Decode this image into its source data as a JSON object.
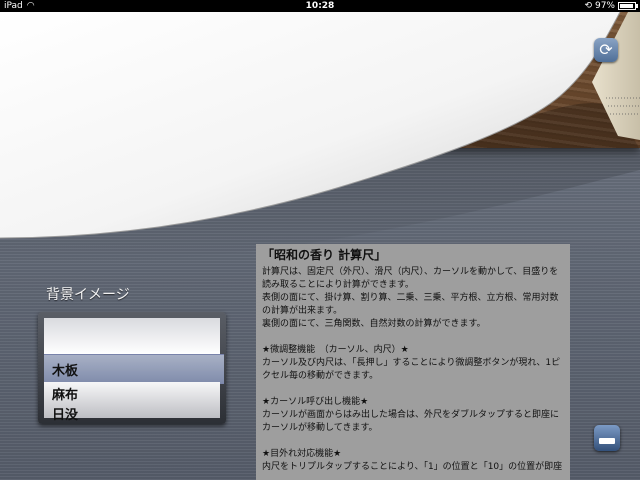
{
  "status_bar": {
    "device": "iPad",
    "time": "10:28",
    "battery": "97%"
  },
  "picker": {
    "label": "背景イメージ",
    "options": [
      "木板",
      "麻布",
      "日没"
    ],
    "selected": "木板"
  },
  "text_panel": {
    "title": "「昭和の香り 計算尺」",
    "paragraphs": [
      "計算尺は、固定尺（外尺）、滑尺（内尺）、カーソルを動かして、目盛りを読み取ることにより計算ができます。",
      "表側の面にて、掛け算、割り算、二乗、三乗、平方根、立方根、常用対数の計算が出来ます。",
      "裏側の面にて、三角関数、自然対数の計算ができます。",
      "",
      "★微調整機能　（カーソル、内尺）★",
      "カーソル及び内尺は、「長押し」することにより微調整ボタンが現れ、1ピクセル毎の移動ができます。",
      "",
      "★カーソル呼び出し機能★",
      "カーソルが画面からはみ出した場合は、外尺をダブルタップすると即座にカーソルが移動してきます。",
      "",
      "★目外れ対応機能★",
      "内尺をトリプルタップすることにより、「1」の位置と「10」の位置が即座"
    ]
  },
  "icons": {
    "refresh": "refresh-icon",
    "ruler": "ruler-icon"
  }
}
